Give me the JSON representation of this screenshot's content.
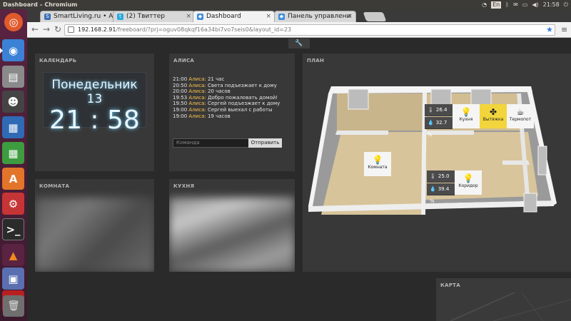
{
  "system": {
    "window_title": "Dashboard – Chromium",
    "lang": "En",
    "clock": "21:58"
  },
  "tabs": [
    {
      "label": "SmartLiving.ru • Ак",
      "icon_color": "#3b6fb6"
    },
    {
      "label": "(2) Твиттер",
      "icon_color": "#2aa9e0"
    },
    {
      "label": "Dashboard",
      "icon_color": "#3d8ddc"
    },
    {
      "label": "Панель управлени",
      "icon_color": "#3d8ddc"
    }
  ],
  "address": {
    "host": "192.168.2.91",
    "path": "/freeboard/?prj=oguv08qkqf16a34bi7vo7seis0&layout_id=23"
  },
  "panes": {
    "calendar": {
      "title": "КАЛЕНДАРЬ",
      "day": "Понедельник 13",
      "time": "21 : 58"
    },
    "alice": {
      "title": "АЛИСА",
      "log": [
        {
          "time": "21:00",
          "who": "Алиса:",
          "text": "21 час"
        },
        {
          "time": "20:50",
          "who": "Алиса:",
          "text": "Света подъезжает к дому"
        },
        {
          "time": "20:00",
          "who": "Алиса:",
          "text": "20 часов"
        },
        {
          "time": "19:53",
          "who": "Алиса:",
          "text": "Добро пожаловать домой!"
        },
        {
          "time": "19:50",
          "who": "Алиса:",
          "text": "Сергей подъезжает к дому"
        },
        {
          "time": "19:00",
          "who": "Алиса:",
          "text": "Сергей выехал с работы"
        },
        {
          "time": "19:00",
          "who": "Алиса:",
          "text": "19 часов"
        }
      ],
      "input_placeholder": "Команда",
      "send_label": "Отправить"
    },
    "plan": {
      "title": "ПЛАН",
      "kitchen_temp": "26.4 °C",
      "kitchen_hum": "32.7 %",
      "corridor_temp": "25.0 °C",
      "corridor_hum": "39.4 %",
      "tiles": {
        "kitchen": "Кухня",
        "hood": "Вытяжка",
        "thermopot": "Термопот",
        "room": "Комната",
        "corridor": "Коридор"
      }
    },
    "room": {
      "title": "КОМНАТА"
    },
    "kitchen": {
      "title": "КУХНЯ"
    },
    "map": {
      "title": "КАРТА"
    }
  },
  "colors": {
    "accent_yellow": "#f2d53c",
    "log_name": "#ffc34d",
    "clock_glow": "#6fd2ff"
  }
}
